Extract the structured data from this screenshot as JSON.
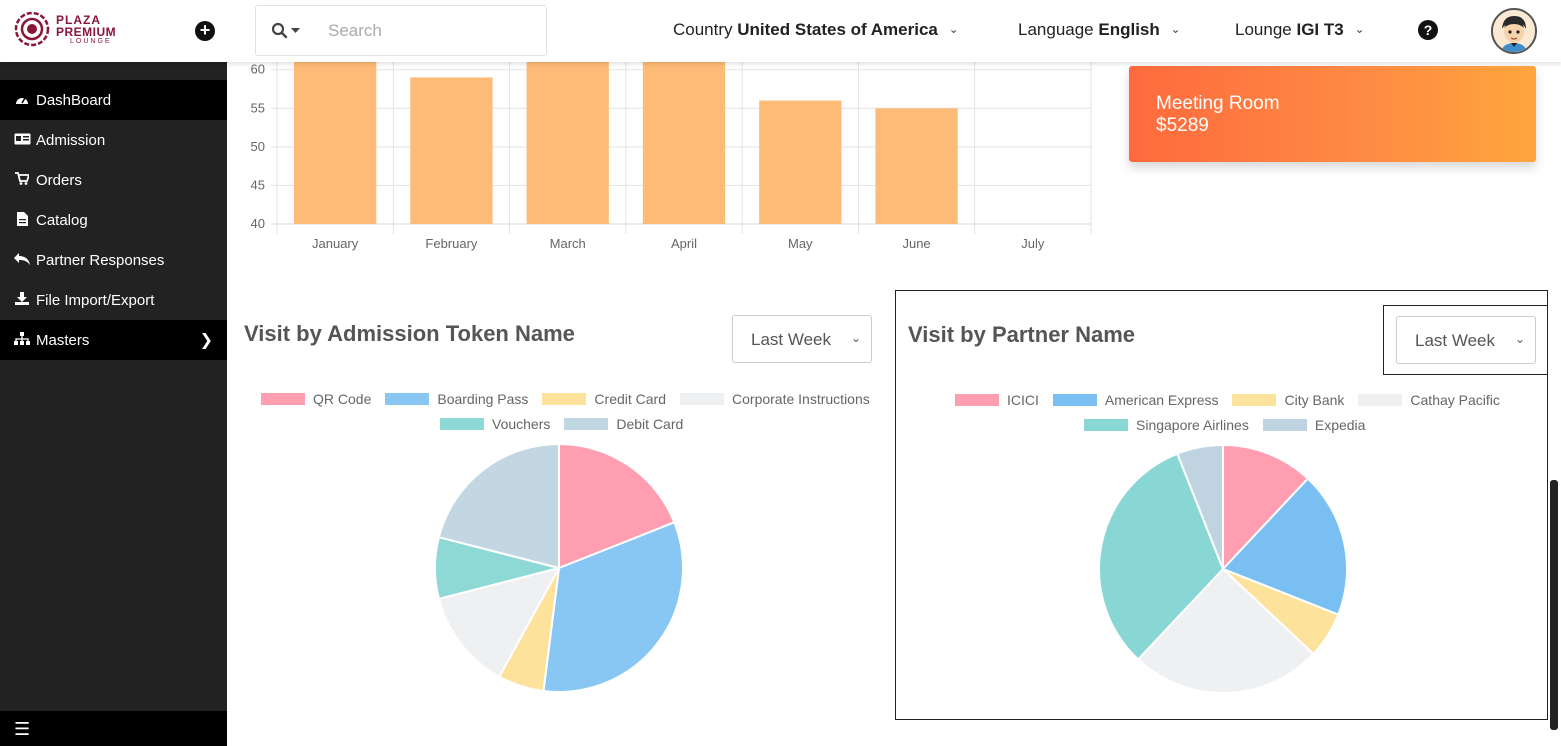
{
  "brand": {
    "line1": "PLAZA",
    "line2": "PREMIUM",
    "line3": "LOUNGE"
  },
  "header": {
    "add_icon": "plus-circle-icon",
    "search": {
      "placeholder": "Search",
      "value": ""
    },
    "country": {
      "label": "Country",
      "value": "United States of America"
    },
    "language": {
      "label": "Language",
      "value": "English"
    },
    "lounge": {
      "label": "Lounge",
      "value": "IGI T3"
    },
    "help_icon": "question-circle-icon"
  },
  "sidebar": {
    "items": [
      {
        "label": "DashBoard",
        "icon": "dashboard-icon"
      },
      {
        "label": "Admission",
        "icon": "id-card-icon"
      },
      {
        "label": "Orders",
        "icon": "cart-icon"
      },
      {
        "label": "Catalog",
        "icon": "file-icon"
      },
      {
        "label": "Partner Responses",
        "icon": "reply-all-icon"
      },
      {
        "label": "File Import/Export",
        "icon": "download-icon"
      },
      {
        "label": "Masters",
        "icon": "sitemap-icon"
      }
    ],
    "menu_icon": "hamburger-icon"
  },
  "meeting_card": {
    "title": "Meeting Room",
    "value": "$5289"
  },
  "token_panel": {
    "title": "Visit by Admission Token Name",
    "filter": "Last Week"
  },
  "partner_panel": {
    "title": "Visit by Partner Name",
    "filter": "Last Week"
  },
  "chart_data": [
    {
      "type": "bar",
      "categories": [
        "January",
        "February",
        "March",
        "April",
        "May",
        "June",
        "July"
      ],
      "values": [
        61,
        59,
        61,
        61,
        56,
        55,
        null
      ],
      "ylim": [
        40,
        61
      ],
      "yticks": [
        40,
        45,
        50,
        55,
        60
      ],
      "grid": true,
      "colors": [
        "#fdbb78"
      ]
    },
    {
      "type": "pie",
      "labels": [
        "QR Code",
        "Boarding Pass",
        "Credit Card",
        "Corporate Instructions",
        "Vouchers",
        "Debit Card"
      ],
      "values": [
        19,
        33,
        6,
        13,
        8,
        21
      ],
      "colors": [
        "#ff9eb0",
        "#88c6f3",
        "#fde29c",
        "#eff0f2",
        "#8ed8d6",
        "#c2d7e2"
      ],
      "legend": "top"
    },
    {
      "type": "pie",
      "labels": [
        "ICICI",
        "American Express",
        "City Bank",
        "Cathay Pacific",
        "Singapore Airlines",
        "Expedia"
      ],
      "values": [
        12,
        19,
        6,
        25,
        32,
        6
      ],
      "colors": [
        "#ff9eb0",
        "#7abff2",
        "#fde29c",
        "#eff0f2",
        "#88d7d5",
        "#bfd4e0"
      ],
      "legend": "top"
    }
  ]
}
